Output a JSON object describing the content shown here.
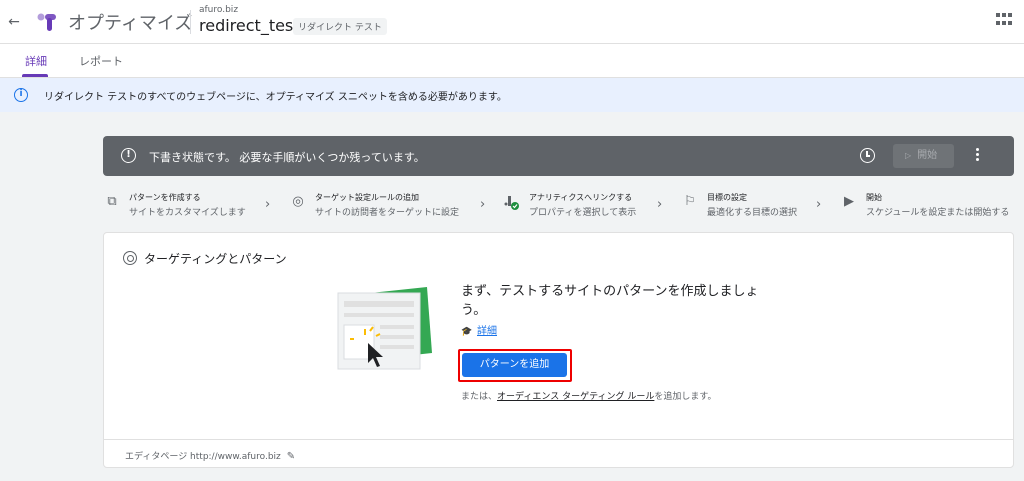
{
  "header": {
    "back_icon": "arrow-back-icon",
    "app_title": "オプティマイズ",
    "account": "afuro.biz",
    "experiment_name": "redirect_test",
    "experiment_type": "リダイレクト テスト",
    "apps_icon": "apps-grid-icon"
  },
  "tabs": [
    {
      "label": "詳細",
      "active": true
    },
    {
      "label": "レポート",
      "active": false
    }
  ],
  "banner": {
    "icon": "info-icon",
    "text": "リダイレクト テストのすべてのウェブページに、オプティマイズ スニペットを含める必要があります。"
  },
  "status_bar": {
    "text": "下書き状態です。 必要な手順がいくつか残っています。",
    "start_label": "開始",
    "bg_color": "#5f6368"
  },
  "steps": [
    {
      "title": "パターンを作成する",
      "sub": "サイトをカスタマイズします",
      "icon": "copy-icon"
    },
    {
      "title": "ターゲット設定ルールの追加",
      "sub": "サイトの訪問者をターゲットに設定",
      "icon": "target-check-icon"
    },
    {
      "title": "アナリティクスへリンクする",
      "sub": "プロパティを選択して表示",
      "icon": "analytics-check-icon"
    },
    {
      "title": "目標の設定",
      "sub": "最適化する目標の選択",
      "icon": "flag-icon"
    },
    {
      "title": "開始",
      "sub": "スケジュールを設定または開始する",
      "icon": "play-circle-icon"
    }
  ],
  "card": {
    "title": "ターゲティングとパターン",
    "empty_title": "まず、テストするサイトのパターンを作成しましょう。",
    "learn_more": "詳細",
    "add_button": "パターンを追加",
    "or_prefix": "または、",
    "or_link": "オーディエンス ターゲティング ルール",
    "or_suffix": "を追加します。",
    "editor_page": "エディタページ http://www.afuro.biz"
  },
  "colors": {
    "accent": "#673ab7",
    "primary_button": "#1a73e8",
    "highlight_border": "#e00000",
    "banner_bg": "#e8f0fe"
  }
}
